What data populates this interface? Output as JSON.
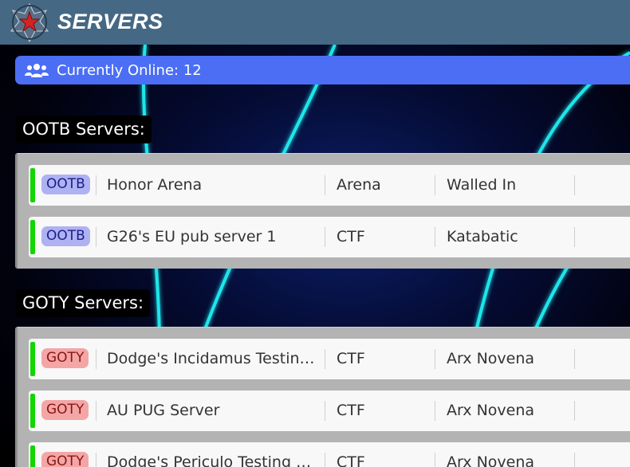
{
  "app": {
    "title": "SERVERS",
    "logo_icon": "star-emblem-icon"
  },
  "online_banner": {
    "icon": "users-icon",
    "text": "Currently Online: 12"
  },
  "sections": [
    {
      "title": "OOTB Servers:",
      "rows": [
        {
          "badge": "OOTB",
          "name": "Honor Arena",
          "mode": "Arena",
          "map": "Walled In"
        },
        {
          "badge": "OOTB",
          "name": "G26's EU pub server 1",
          "mode": "CTF",
          "map": "Katabatic"
        }
      ]
    },
    {
      "title": "GOTY Servers:",
      "rows": [
        {
          "badge": "GOTY",
          "name": "Dodge's Incidamus Testing Server",
          "mode": "CTF",
          "map": "Arx Novena"
        },
        {
          "badge": "GOTY",
          "name": "AU PUG Server",
          "mode": "CTF",
          "map": "Arx Novena"
        },
        {
          "badge": "GOTY",
          "name": "Dodge's Periculo Testing Server",
          "mode": "CTF",
          "map": "Arx Novena"
        }
      ]
    }
  ],
  "colors": {
    "header": "#456884",
    "banner": "#4b6ef5",
    "status_online": "#11d600",
    "badge_ootb": "#aeb2f2",
    "badge_goty": "#f4a6a6"
  }
}
